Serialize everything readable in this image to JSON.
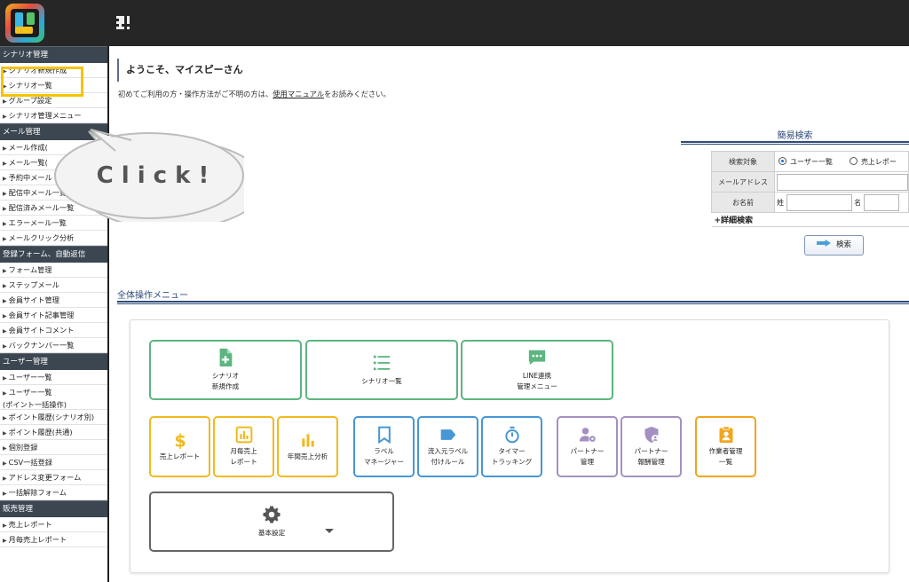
{
  "sidebar": {
    "sections": [
      {
        "title": "シナリオ管理",
        "items": [
          "シナリオ新規作成",
          "シナリオ一覧",
          "グループ設定",
          "シナリオ管理メニュー"
        ]
      },
      {
        "title": "メール管理",
        "items": [
          "メール作成(",
          "メール一覧(",
          "予約中メール",
          "配信中メール一覧",
          "配信済みメール一覧",
          "エラーメール一覧",
          "メールクリック分析"
        ]
      },
      {
        "title": "登録フォーム、自動返信",
        "items": [
          "フォーム管理",
          "ステップメール",
          "会員サイト管理",
          "会員サイト記事管理",
          "会員サイトコメント",
          "バックナンバー一覧"
        ]
      },
      {
        "title": "ユーザー管理",
        "items": [
          "ユーザー一覧",
          "ユーザー一覧\n(ポイント一括操作)",
          "ポイント履歴(シナリオ別)",
          "ポイント履歴(共通)",
          "個別登録",
          "CSV一括登録",
          "アドレス変更フォーム",
          "一括解除フォーム"
        ]
      },
      {
        "title": "販売管理",
        "items": [
          "売上レポート",
          "月毎売上レポート"
        ]
      }
    ]
  },
  "callout": {
    "text": "C l i c k !"
  },
  "welcome": "ようこそ、マイスピーさん",
  "guide": {
    "before": "初めてご利用の方・操作方法がご不明の方は、",
    "link": "使用マニュアル",
    "after": "をお読みください。"
  },
  "quick_search": {
    "title": "簡易検索",
    "target_label": "検索対象",
    "target_options": [
      "ユーザー一覧",
      "売上レポー"
    ],
    "target_selected": "ユーザー一覧",
    "email_label": "メールアドレス",
    "email_value": "",
    "name_label": "お名前",
    "last_name_label": "姓",
    "last_name_value": "",
    "first_name_label": "名",
    "first_name_value": "",
    "advanced_label": "+詳細検索",
    "search_button": "検索"
  },
  "menu": {
    "title": "全体操作メニュー",
    "cards_row1": [
      {
        "label": "シナリオ\n新規作成",
        "icon": "file-plus-icon",
        "color": "#5db57f"
      },
      {
        "label": "シナリオ一覧",
        "icon": "list-icon",
        "color": "#5db57f"
      },
      {
        "label": "LINE連携\n管理メニュー",
        "icon": "chat-bubble-icon",
        "color": "#5db57f"
      }
    ],
    "cards_row2": [
      {
        "label": "売上レポート",
        "icon": "dollar-icon",
        "color": "#f1b91e"
      },
      {
        "label": "月毎売上\nレポート",
        "icon": "bar-chart-box-icon",
        "color": "#f1b91e"
      },
      {
        "label": "年間売上分析",
        "icon": "bar-chart-icon",
        "color": "#f1b91e"
      },
      {
        "label": "ラベル\nマネージャー",
        "icon": "bookmark-icon",
        "color": "#4797d6"
      },
      {
        "label": "流入元ラベル\n付けルール",
        "icon": "tag-icon",
        "color": "#4797d6"
      },
      {
        "label": "タイマー\nトラッキング",
        "icon": "stopwatch-icon",
        "color": "#4797d6"
      },
      {
        "label": "パートナー\n管理",
        "icon": "user-gear-icon",
        "color": "#a490c1"
      },
      {
        "label": "パートナー\n報酬管理",
        "icon": "shield-user-icon",
        "color": "#a490c1"
      },
      {
        "label": "作業者管理\n一覧",
        "icon": "id-badge-icon",
        "color": "#f2a51f"
      }
    ],
    "settings_card": {
      "label": "基本設定",
      "icon": "gear-icon"
    }
  }
}
